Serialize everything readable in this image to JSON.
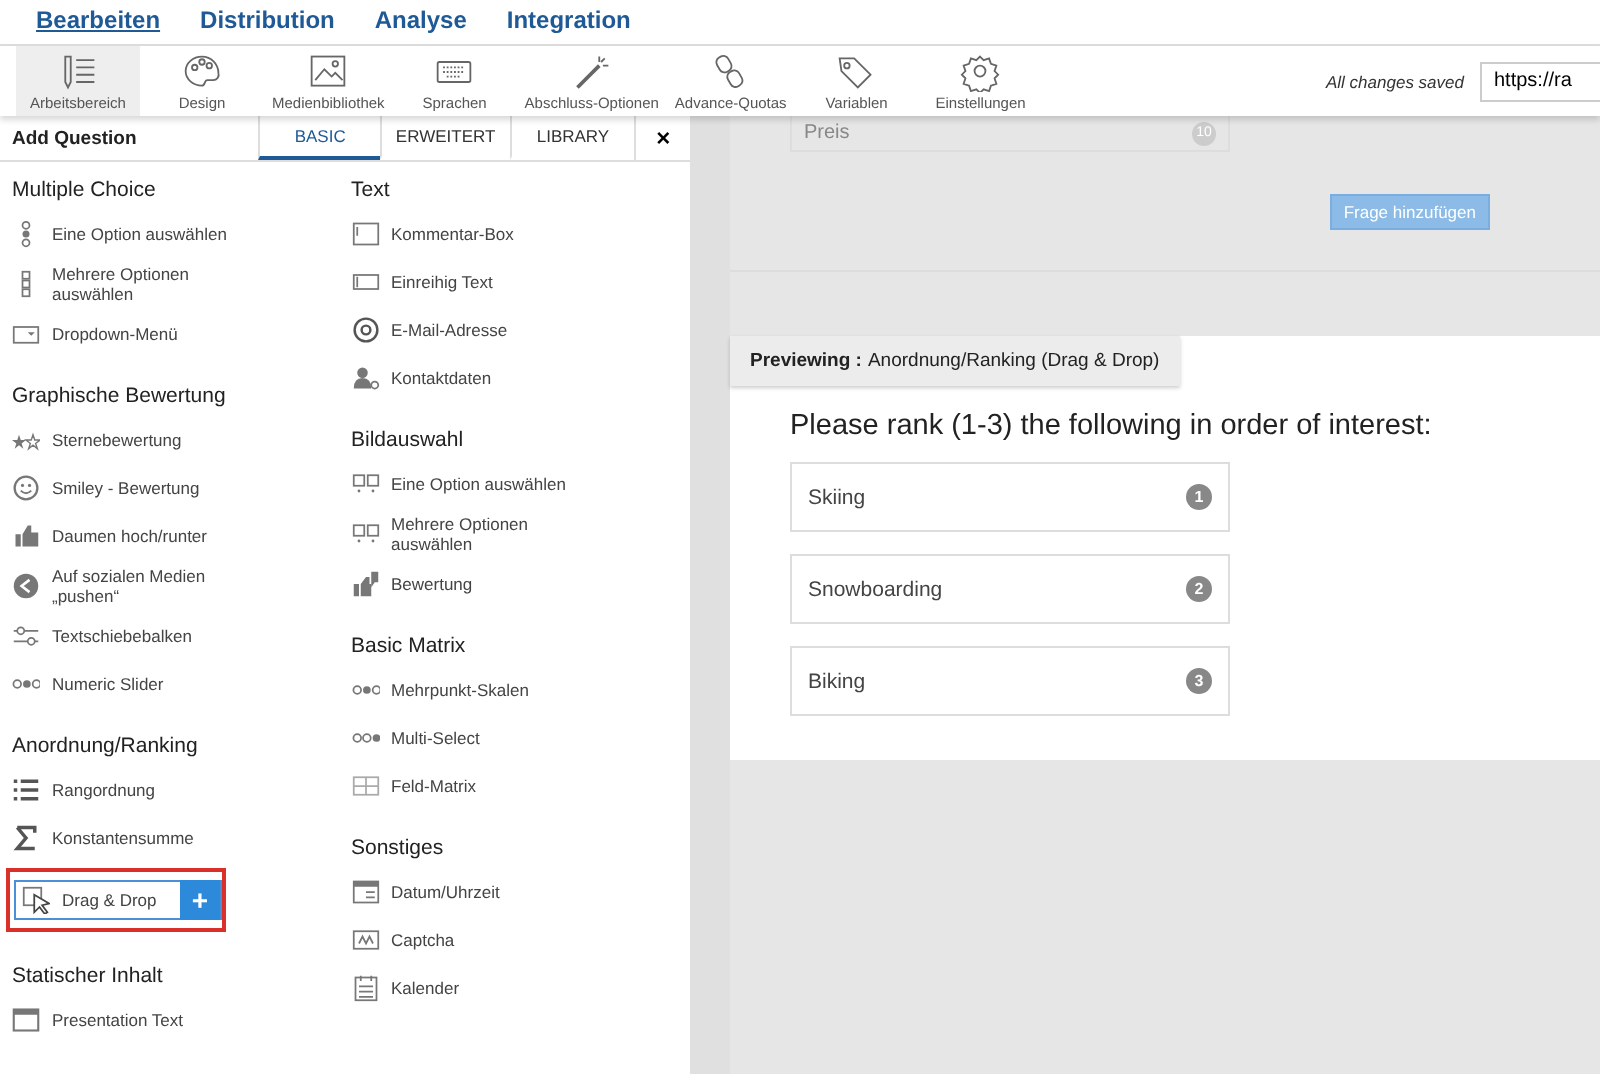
{
  "nav_tabs": [
    {
      "label": "Bearbeiten",
      "selected": true
    },
    {
      "label": "Distribution",
      "selected": false
    },
    {
      "label": "Analyse",
      "selected": false
    },
    {
      "label": "Integration",
      "selected": false
    }
  ],
  "toolbar": {
    "items": [
      {
        "label": "Arbeitsbereich",
        "selected": true
      },
      {
        "label": "Design",
        "selected": false
      },
      {
        "label": "Medienbibliothek",
        "selected": false
      },
      {
        "label": "Sprachen",
        "selected": false
      },
      {
        "label": "Abschluss-Optionen",
        "selected": false
      },
      {
        "label": "Advance-Quotas",
        "selected": false
      },
      {
        "label": "Variablen",
        "selected": false
      },
      {
        "label": "Einstellungen",
        "selected": false
      }
    ],
    "save_status": "All changes saved",
    "url": "https://ra"
  },
  "panel": {
    "title": "Add Question",
    "tabs": [
      {
        "label": "BASIC",
        "selected": true
      },
      {
        "label": "ERWEITERT",
        "selected": false
      },
      {
        "label": "LIBRARY",
        "selected": false
      }
    ],
    "close": "×",
    "add_symbol": "+",
    "columns": [
      [
        {
          "heading": "Multiple Choice",
          "items": [
            {
              "label": "Eine Option auswählen",
              "selected": false
            },
            {
              "label": "Mehrere Optionen auswählen",
              "selected": false
            },
            {
              "label": "Dropdown-Menü",
              "selected": false
            }
          ]
        },
        {
          "heading": "Graphische Bewertung",
          "items": [
            {
              "label": "Sternebewertung",
              "selected": false
            },
            {
              "label": "Smiley - Bewertung",
              "selected": false
            },
            {
              "label": "Daumen hoch/runter",
              "selected": false
            },
            {
              "label": "Auf sozialen Medien „pushen“",
              "selected": false
            },
            {
              "label": "Textschiebebalken",
              "selected": false
            },
            {
              "label": "Numeric Slider",
              "selected": false
            }
          ]
        },
        {
          "heading": "Anordnung/Ranking",
          "items": [
            {
              "label": "Rangordnung",
              "selected": false
            },
            {
              "label": "Konstantensumme",
              "selected": false
            },
            {
              "label": "Drag & Drop",
              "selected": true
            }
          ]
        },
        {
          "heading": "Statischer Inhalt",
          "items": [
            {
              "label": "Presentation Text",
              "selected": false
            }
          ]
        }
      ],
      [
        {
          "heading": "Text",
          "items": [
            {
              "label": "Kommentar-Box",
              "selected": false
            },
            {
              "label": "Einreihig Text",
              "selected": false
            },
            {
              "label": "E-Mail-Adresse",
              "selected": false
            },
            {
              "label": "Kontaktdaten",
              "selected": false
            }
          ]
        },
        {
          "heading": "Bildauswahl",
          "items": [
            {
              "label": "Eine Option auswählen",
              "selected": false
            },
            {
              "label": "Mehrere Optionen auswählen",
              "selected": false
            },
            {
              "label": "Bewertung",
              "selected": false
            }
          ]
        },
        {
          "heading": "Basic Matrix",
          "items": [
            {
              "label": "Mehrpunkt-Skalen",
              "selected": false
            },
            {
              "label": "Multi-Select",
              "selected": false
            },
            {
              "label": "Feld-Matrix",
              "selected": false
            }
          ]
        },
        {
          "heading": "Sonstiges",
          "items": [
            {
              "label": "Datum/Uhrzeit",
              "selected": false
            },
            {
              "label": "Captcha",
              "selected": false
            },
            {
              "label": "Kalender",
              "selected": false
            }
          ]
        }
      ]
    ]
  },
  "canvas": {
    "prev_card": {
      "label": "Preis",
      "badge": "10"
    },
    "add_button": "Frage hinzufügen",
    "preview": {
      "label": "Previewing :",
      "title": "Anordnung/Ranking (Drag & Drop)",
      "question": "Please rank (1-3) the following in order of interest:",
      "options": [
        {
          "label": "Skiing",
          "rank": "1"
        },
        {
          "label": "Snowboarding",
          "rank": "2"
        },
        {
          "label": "Biking",
          "rank": "3"
        }
      ]
    }
  }
}
